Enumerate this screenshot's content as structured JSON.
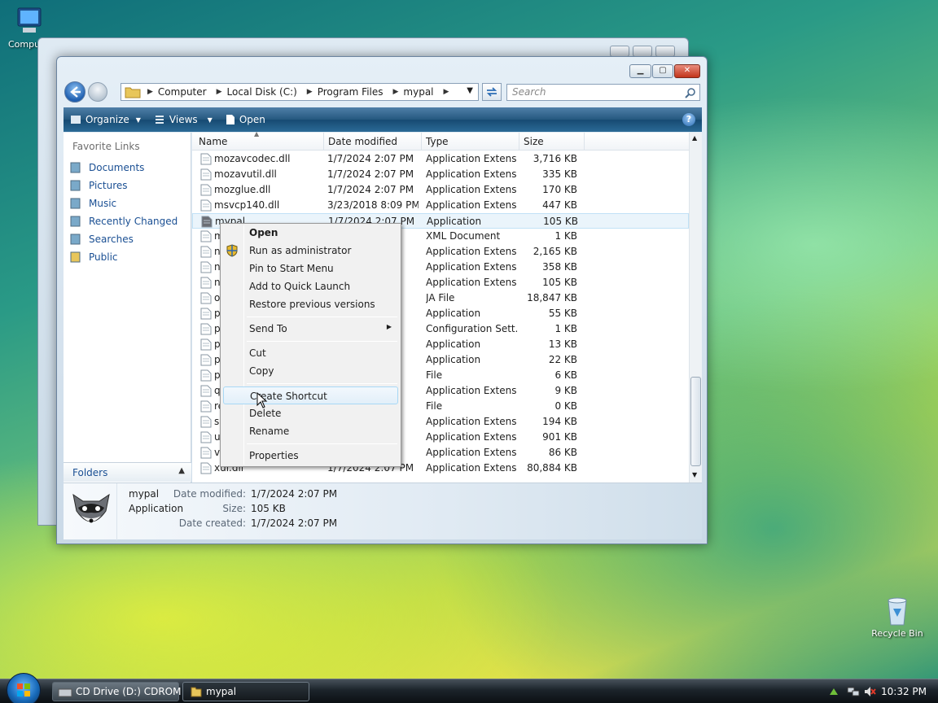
{
  "desktop": {
    "computer_label": "Compu",
    "recycle_label": "Recycle Bin"
  },
  "window": {
    "address": [
      "Computer",
      "Local Disk (C:)",
      "Program Files",
      "mypal"
    ],
    "search_placeholder": "Search",
    "toolbar": {
      "organize": "Organize",
      "views": "Views",
      "open": "Open"
    },
    "favorites_header": "Favorite Links",
    "favorites": [
      "Documents",
      "Pictures",
      "Music",
      "Recently Changed",
      "Searches",
      "Public"
    ],
    "folders_label": "Folders",
    "columns": {
      "name": "Name",
      "date": "Date modified",
      "type": "Type",
      "size": "Size"
    },
    "files": [
      {
        "name": "mozavcodec.dll",
        "date": "1/7/2024 2:07 PM",
        "type": "Application Extens...",
        "size": "3,716 KB"
      },
      {
        "name": "mozavutil.dll",
        "date": "1/7/2024 2:07 PM",
        "type": "Application Extens...",
        "size": "335 KB"
      },
      {
        "name": "mozglue.dll",
        "date": "1/7/2024 2:07 PM",
        "type": "Application Extens...",
        "size": "170 KB"
      },
      {
        "name": "msvcp140.dll",
        "date": "3/23/2018 8:09 PM",
        "type": "Application Extens...",
        "size": "447 KB"
      },
      {
        "name": "mypal",
        "date": "1/7/2024 2:07 PM",
        "type": "Application",
        "size": "105 KB"
      },
      {
        "name": "m",
        "date": "M",
        "type": "XML Document",
        "size": "1 KB"
      },
      {
        "name": "n",
        "date": "",
        "type": "Application Extens...",
        "size": "2,165 KB"
      },
      {
        "name": "n",
        "date": "",
        "type": "Application Extens...",
        "size": "358 KB"
      },
      {
        "name": "n",
        "date": "",
        "type": "Application Extens...",
        "size": "105 KB"
      },
      {
        "name": "o",
        "date": "",
        "type": "JA File",
        "size": "18,847 KB"
      },
      {
        "name": "p",
        "date": "",
        "type": "Application",
        "size": "55 KB"
      },
      {
        "name": "p",
        "date": "",
        "type": "Configuration Sett...",
        "size": "1 KB"
      },
      {
        "name": "p",
        "date": "",
        "type": "Application",
        "size": "13 KB"
      },
      {
        "name": "p",
        "date": "",
        "type": "Application",
        "size": "22 KB"
      },
      {
        "name": "p",
        "date": "",
        "type": "File",
        "size": "6 KB"
      },
      {
        "name": "q",
        "date": "",
        "type": "Application Extens...",
        "size": "9 KB"
      },
      {
        "name": "re",
        "date": "",
        "type": "File",
        "size": "0 KB"
      },
      {
        "name": "s",
        "date": "",
        "type": "Application Extens...",
        "size": "194 KB"
      },
      {
        "name": "u",
        "date": "",
        "type": "Application Extens...",
        "size": "901 KB"
      },
      {
        "name": "v",
        "date": "M",
        "type": "Application Extens...",
        "size": "86 KB"
      },
      {
        "name": "xul.dll",
        "date": "1/7/2024 2:07 PM",
        "type": "Application Extens...",
        "size": "80,884 KB"
      }
    ],
    "details": {
      "name": "mypal",
      "kind": "Application",
      "modified_label": "Date modified:",
      "modified": "1/7/2024 2:07 PM",
      "size_label": "Size:",
      "size": "105 KB",
      "created_label": "Date created:",
      "created": "1/7/2024 2:07 PM"
    }
  },
  "context_menu": {
    "open": "Open",
    "run_admin": "Run as administrator",
    "pin_start": "Pin to Start Menu",
    "quick_launch": "Add to Quick Launch",
    "restore": "Restore previous versions",
    "send_to": "Send To",
    "cut": "Cut",
    "copy": "Copy",
    "create_shortcut": "Create Shortcut",
    "delete": "Delete",
    "rename": "Rename",
    "properties": "Properties"
  },
  "taskbar": {
    "cd_drive": "CD Drive (D:) CDROM",
    "mypal": "mypal",
    "clock": "10:32 PM"
  },
  "colors": {
    "link_blue": "#1a4f93",
    "toolbar_blue": "#25587f",
    "close_red": "#c2341a"
  }
}
